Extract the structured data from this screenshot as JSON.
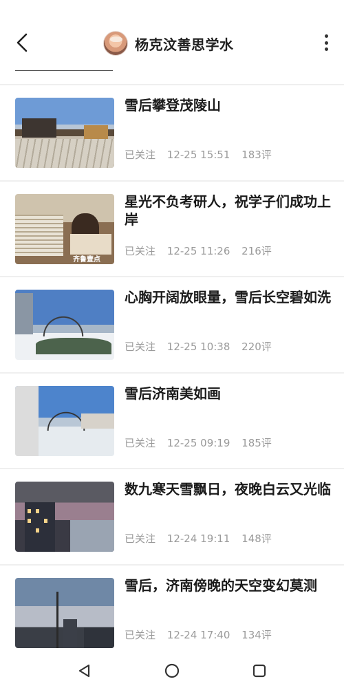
{
  "header": {
    "back_icon": "chevron-left-icon",
    "author_name": "杨克汶善思学水",
    "more_icon": "more-vertical-icon"
  },
  "feed": {
    "items": [
      {
        "title": "雪后攀登茂陵山",
        "follow": "已关注",
        "time": "12-25 15:51",
        "comments": "183评"
      },
      {
        "title": "星光不负考研人，祝学子们成功上岸",
        "follow": "已关注",
        "time": "12-25 11:26",
        "comments": "216评",
        "watermark": "齐鲁壹点"
      },
      {
        "title": "心胸开阔放眼量，雪后长空碧如洗",
        "follow": "已关注",
        "time": "12-25 10:38",
        "comments": "220评"
      },
      {
        "title": "雪后济南美如画",
        "follow": "已关注",
        "time": "12-25 09:19",
        "comments": "185评"
      },
      {
        "title": "数九寒天雪飘日，夜晚白云又光临",
        "follow": "已关注",
        "time": "12-24 19:11",
        "comments": "148评"
      },
      {
        "title": "雪后，济南傍晚的天空变幻莫测",
        "follow": "已关注",
        "time": "12-24 17:40",
        "comments": "134评"
      }
    ]
  },
  "navbar": {
    "back_icon": "triangle-back-icon",
    "home_icon": "circle-home-icon",
    "recents_icon": "square-recents-icon"
  }
}
